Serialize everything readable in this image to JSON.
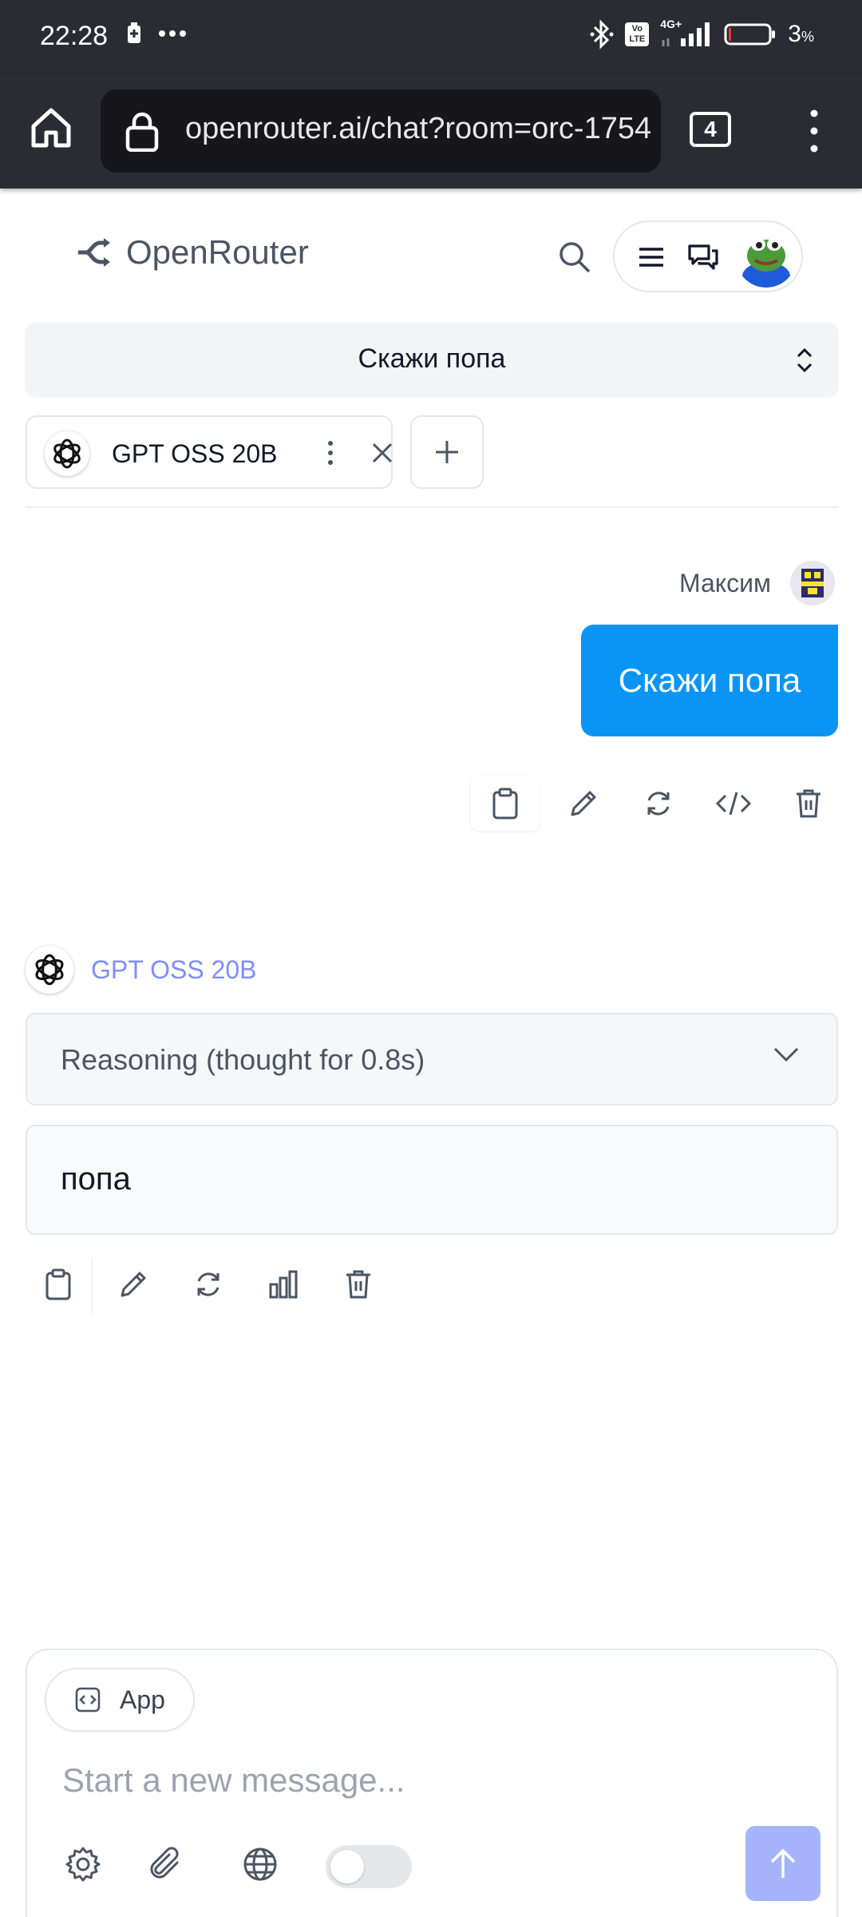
{
  "status_bar": {
    "time": "22:28",
    "battery": "3",
    "battery_unit": "%",
    "network": "4G+",
    "volte_label_top": "Vo",
    "volte_label_bottom": "LTE"
  },
  "browser": {
    "url": "openrouter.ai/chat?room=orc-1754",
    "tab_count": "4"
  },
  "header": {
    "brand": "OpenRouter"
  },
  "room": {
    "title": "Скажи попа"
  },
  "model_chip": {
    "name": "GPT OSS 20B"
  },
  "user_message": {
    "author": "Максим",
    "text": "Скажи попа"
  },
  "assistant_message": {
    "model": "GPT OSS 20B",
    "reasoning_label": "Reasoning (thought for 0.8s)",
    "text": "попа"
  },
  "composer": {
    "app_label": "App",
    "placeholder": "Start a new message..."
  },
  "colors": {
    "user_bubble": "#0a95f5",
    "model_name_accent": "#818cf8",
    "send_button": "#a5b4fc",
    "chrome_bar": "#2b2b33"
  }
}
